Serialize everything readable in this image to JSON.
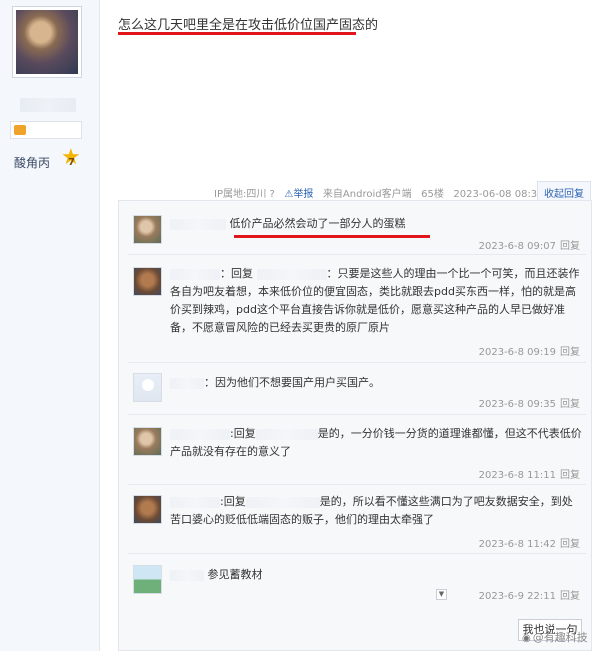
{
  "sidebar": {
    "level_name": "酸角丙",
    "level_number": "7"
  },
  "post": {
    "text": "怎么这几天吧里全是在攻击低价位国产固态的"
  },
  "meta": {
    "ip": "IP属地:四川",
    "help_icon": "?",
    "warn_icon": "⚠",
    "report": "举报",
    "source": "来自Android客户端",
    "floor": "65楼",
    "datetime": "2023-06-08 08:39",
    "collapse": "收起回复"
  },
  "replies": [
    {
      "avatar": "face-avatar",
      "text": "低价产品必然会动了一部分人的蛋糕",
      "date": "2023-6-8 09:07",
      "action": "回复"
    },
    {
      "avatar": "cat-avatar",
      "prefix": "回复",
      "colon": "：",
      "text": "只要是这些人的理由一个比一个可笑，而且还装作各自为吧友着想，本来低价位的便宜固态，类比就跟去pdd买东西一样，怕的就是高价买到辣鸡，pdd这个平台直接告诉你就是低价，愿意买这种产品的人早已做好准备，不愿意冒风险的已经去买更贵的原厂原片",
      "date": "2023-6-8 09:19",
      "action": "回复"
    },
    {
      "avatar": "blank-avatar",
      "colon": "：",
      "text": "因为他们不想要国产用户买国产。",
      "date": "2023-6-8 09:35",
      "action": "回复"
    },
    {
      "avatar": "face-avatar",
      "colon": ":",
      "prefix": "回复",
      "text": "是的，一分价钱一分货的道理谁都懂，但这不代表低价产品就没有存在的意义了",
      "date": "2023-6-8 11:11",
      "action": "回复"
    },
    {
      "avatar": "cat-avatar",
      "colon": ":",
      "prefix": "回复",
      "text": "是的，所以看不懂这些满口为了吧友数据安全，到处苦口婆心的贬低低端固态的贩子，他们的理由太牵强了",
      "date": "2023-6-8 11:42",
      "action": "回复"
    },
    {
      "avatar": "landscape-avatar",
      "text": "参见蓄教材",
      "date": "2023-6-9 22:11",
      "action": "回复"
    }
  ],
  "footer": {
    "dropdown": "▼",
    "say_button": "我也说一句"
  },
  "watermark": {
    "text": "@有趣科技",
    "logo_icon": "weibo-icon"
  },
  "colors": {
    "highlight": "#e0161b",
    "link": "#2d64b3"
  }
}
